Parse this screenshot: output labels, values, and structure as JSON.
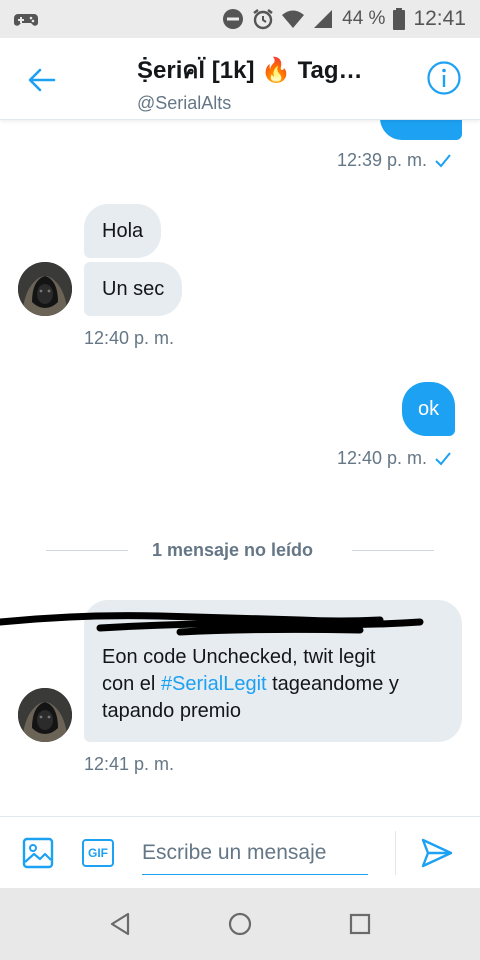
{
  "status_bar": {
    "battery_percent": "44 %",
    "time": "12:41",
    "icons": [
      "game-controller-icon",
      "do-not-disturb-icon",
      "alarm-icon",
      "wifi-icon",
      "cellular-signal-icon",
      "battery-icon"
    ]
  },
  "header": {
    "title": "Ṩeriคl̈ [1k] 🔥 Tag…",
    "handle": "@SerialAlts",
    "back_icon": "back-arrow-icon",
    "info_icon": "info-icon"
  },
  "messages": {
    "out_1": {
      "time": "12:39 p. m."
    },
    "in_1": {
      "text": "Hola"
    },
    "in_2": {
      "text": "Un sec",
      "time": "12:40 p. m."
    },
    "out_2": {
      "text": "ok",
      "time": "12:40 p. m."
    },
    "unread_divider": "1 mensaje no leído",
    "in_3": {
      "line1": "Eon code Unchecked, twit legit",
      "line2_prefix": "con el ",
      "hashtag": "#SerialLegit",
      "line2_suffix": " tageandome y",
      "line3": "tapando premio",
      "time": "12:41 p. m."
    }
  },
  "composer": {
    "placeholder": "Escribe un mensaje",
    "gif_label": "GIF",
    "image_icon": "image-icon",
    "send_icon": "send-icon"
  },
  "nav_bar": {
    "icons": [
      "back-triangle-icon",
      "home-circle-icon",
      "recents-square-icon"
    ]
  },
  "colors": {
    "accent": "#1da1f2",
    "bubble_in": "#e6ecf0",
    "muted": "#657786"
  }
}
